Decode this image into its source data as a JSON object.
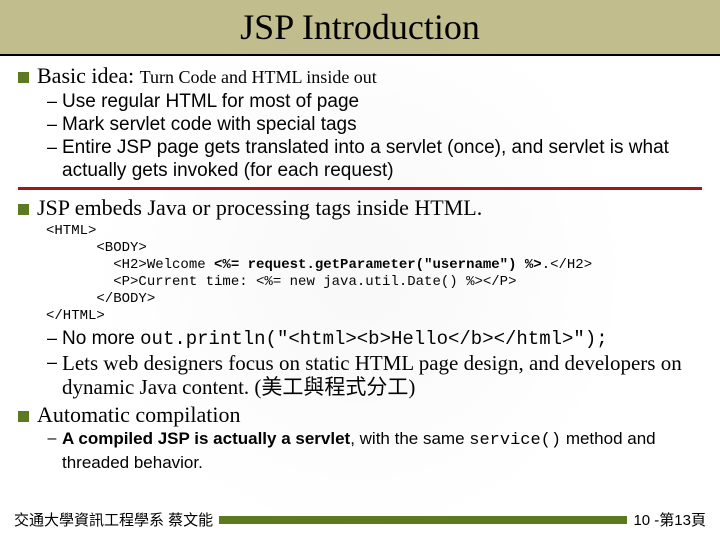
{
  "title": "JSP Introduction",
  "b1": {
    "lead": "Basic idea: ",
    "rest": "Turn Code and HTML inside out",
    "d1": "Use regular HTML for most of page",
    "d2": "Mark servlet code with special tags",
    "d3": "Entire JSP page gets translated into a servlet (once), and servlet is what actually gets invoked (for each request)"
  },
  "b2": {
    "text": "JSP embeds Java or processing tags inside HTML.",
    "code_l1": "<HTML>",
    "code_l2": "      <BODY>",
    "code_l3a": "        <H2>Welcome ",
    "code_l3b": "<%= request.getParameter(\"username\") %>",
    "code_l3c": ".</H2>",
    "code_l4": "        <P>Current time: <%= new java.util.Date() %></P>",
    "code_l5": "      </BODY>",
    "code_l6": "</HTML>",
    "d1a": "No more ",
    "d1b": "out.println(\"<html><b>Hello</b></html>\");",
    "d2": "Lets web designers focus on static HTML page design, and developers on dynamic Java content. (美工與程式分工)"
  },
  "b3": {
    "text": "Automatic compilation",
    "d1a": "A compiled JSP is actually a servlet",
    "d1b": ", with the same ",
    "d1c": "service()",
    "d1d": " method and threaded behavior."
  },
  "footer": {
    "left": "交通大學資訊工程學系 蔡文能",
    "right": "10 -第13頁"
  }
}
